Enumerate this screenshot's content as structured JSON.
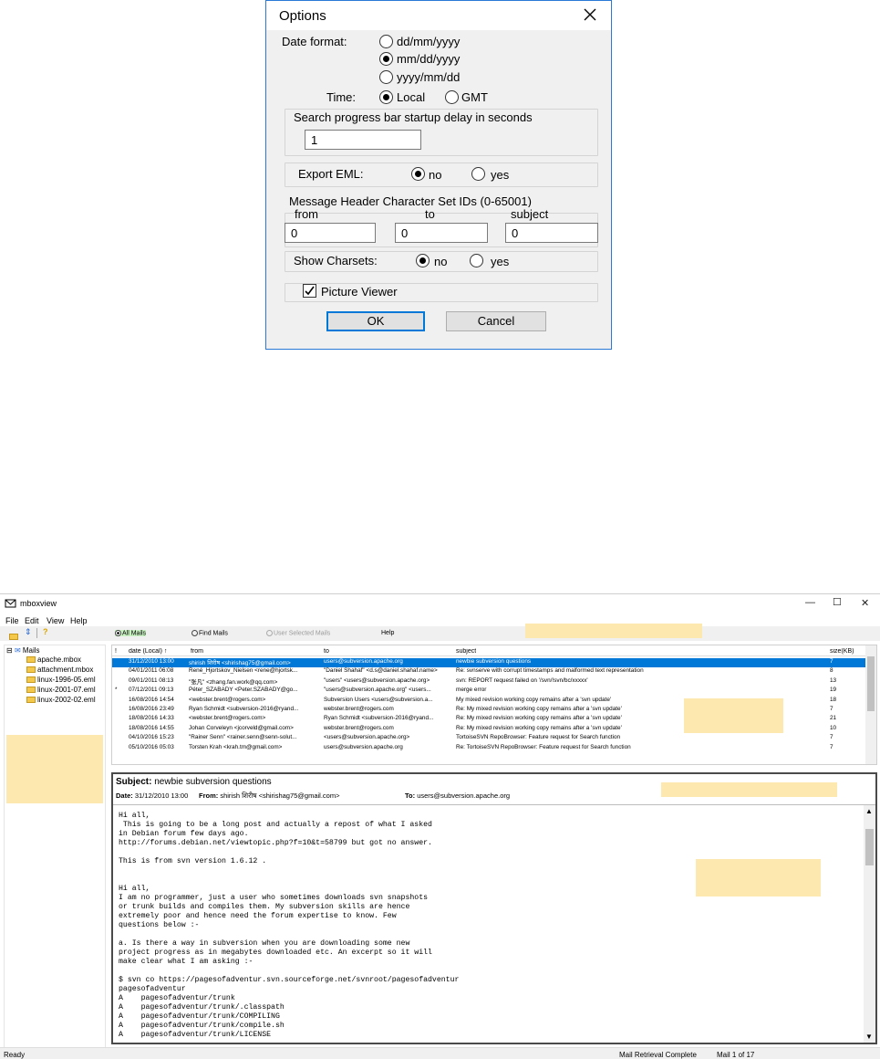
{
  "dialog": {
    "title": "Options",
    "date_format_label": "Date format:",
    "date_formats": [
      "dd/mm/yyyy",
      "mm/dd/yyyy",
      "yyyy/mm/dd"
    ],
    "date_format_selected": "mm/dd/yyyy",
    "time_label": "Time:",
    "time_options": [
      "Local",
      "GMT"
    ],
    "time_selected": "Local",
    "search_delay_label": "Search progress bar startup delay in seconds",
    "search_delay_value": "1",
    "export_eml_label": "Export EML:",
    "export_eml_options": [
      "no",
      "yes"
    ],
    "export_eml_selected": "no",
    "charset_label": "Message Header Character Set IDs (0-65001)",
    "charset_from_label": "from",
    "charset_to_label": "to",
    "charset_subject_label": "subject",
    "charset_from_value": "0",
    "charset_to_value": "0",
    "charset_subject_value": "0",
    "show_charsets_label": "Show Charsets:",
    "show_charsets_options": [
      "no",
      "yes"
    ],
    "show_charsets_selected": "no",
    "picture_viewer_label": "Picture Viewer",
    "picture_viewer_checked": true,
    "ok_label": "OK",
    "cancel_label": "Cancel"
  },
  "app": {
    "title": "mboxview",
    "menu": [
      "File",
      "Edit",
      "View",
      "Help"
    ],
    "tree": {
      "root": "Mails",
      "items": [
        "apache.mbox",
        "attachment.mbox",
        "linux-1996-05.eml",
        "linux-2001-07.eml",
        "linux-2002-02.eml"
      ]
    },
    "filter": {
      "all_mails": "All Mails",
      "find_mails": "Find Mails",
      "user_selected": "User Selected Mails",
      "help": "Help"
    },
    "columns": [
      "!",
      "date (Local) ↑",
      "from",
      "to",
      "subject",
      "size(KB)"
    ],
    "rows": [
      {
        "flag": "",
        "date": "31/12/2010 13:00",
        "from": "shirish शिरीष <shirishag75@gmail.com>",
        "to": "users@subversion.apache.org",
        "subject": "newbie subversion questions",
        "size": "7"
      },
      {
        "flag": "",
        "date": "04/01/2011 06:08",
        "from": "René_Hjortskov_Nielsen <rene@hjortsk...",
        "to": "\"Daniel Shahaf\" <d.s@daniel.shahaf.name>",
        "subject": "Re: svnserve with corrupt timestamps and malformed text representation",
        "size": "8"
      },
      {
        "flag": "",
        "date": "09/01/2011 08:13",
        "from": "\"张凡\" <zhang.fan.work@qq.com>",
        "to": "\"users\" <users@subversion.apache.org>",
        "subject": "svn: REPORT request failed on '/svn/!svn/bc/xxxxx'",
        "size": "13"
      },
      {
        "flag": "*",
        "date": "07/12/2011 09:13",
        "from": "Péter_SZABADY <Peter.SZABADY@go...",
        "to": "\"users@subversion.apache.org\" <users...",
        "subject": "merge error",
        "size": "19"
      },
      {
        "flag": "",
        "date": "16/08/2016 14:54",
        "from": "<webster.brent@rogers.com>",
        "to": "Subversion Users <users@subversion.a...",
        "subject": "My mixed revision working copy remains after a 'svn update'",
        "size": "18"
      },
      {
        "flag": "",
        "date": "16/08/2016 23:49",
        "from": "Ryan Schmidt <subversion-2016@ryand...",
        "to": "webster.brent@rogers.com",
        "subject": "Re: My mixed revision working copy remains after a 'svn update'",
        "size": "7"
      },
      {
        "flag": "",
        "date": "18/08/2016 14:33",
        "from": "<webster.brent@rogers.com>",
        "to": "Ryan Schmidt <subversion-2016@ryand...",
        "subject": "Re: My mixed revision working copy remains after a 'svn update'",
        "size": "21"
      },
      {
        "flag": "",
        "date": "18/08/2016 14:55",
        "from": "Johan Corveleyn <jcorveld@gmail.com>",
        "to": "webster.brent@rogers.com",
        "subject": "Re: My mixed revision working copy remains after a 'svn update'",
        "size": "10"
      },
      {
        "flag": "",
        "date": "04/10/2016 15:23",
        "from": "\"Rainer Senn\" <rainer.senn@senn-solut...",
        "to": "<users@subversion.apache.org>",
        "subject": "TortoiseSVN RepoBrowser: Feature request for Search function",
        "size": "7"
      },
      {
        "flag": "",
        "date": "05/10/2016 05:03",
        "from": "Torsten Krah <krah.tm@gmail.com>",
        "to": "users@subversion.apache.org",
        "subject": "Re: TortoiseSVN RepoBrowser: Feature request for Search function",
        "size": "7"
      }
    ],
    "mail": {
      "subject_label": "Subject:",
      "subject": "newbie subversion questions",
      "date_label": "Date:",
      "date": "31/12/2010 13:00",
      "from_label": "From:",
      "from": "shirish शिरीष <shirishag75@gmail.com>",
      "to_label": "To:",
      "to": "users@subversion.apache.org",
      "body": "Hi all,\n This is going to be a long post and actually a repost of what I asked\nin Debian forum few days ago.\nhttp://forums.debian.net/viewtopic.php?f=10&t=58799 but got no answer.\n\nThis is from svn version 1.6.12 .\n\n\nHi all,\nI am no programmer, just a user who sometimes downloads svn snapshots\nor trunk builds and compiles them. My subversion skills are hence\nextremely poor and hence need the forum expertise to know. Few\nquestions below :-\n\na. Is there a way in subversion when you are downloading some new\nproject progress as in megabytes downloaded etc. An excerpt so it will\nmake clear what I am asking :-\n\n$ svn co https://pagesofadventur.svn.sourceforge.net/svnroot/pagesofadventur\npagesofadventur\nA    pagesofadventur/trunk\nA    pagesofadventur/trunk/.classpath\nA    pagesofadventur/trunk/COMPILING\nA    pagesofadventur/trunk/compile.sh\nA    pagesofadventur/trunk/LICENSE"
    },
    "status": {
      "ready": "Ready",
      "retrieval": "Mail Retrieval Complete",
      "position": "Mail 1 of 17"
    }
  }
}
